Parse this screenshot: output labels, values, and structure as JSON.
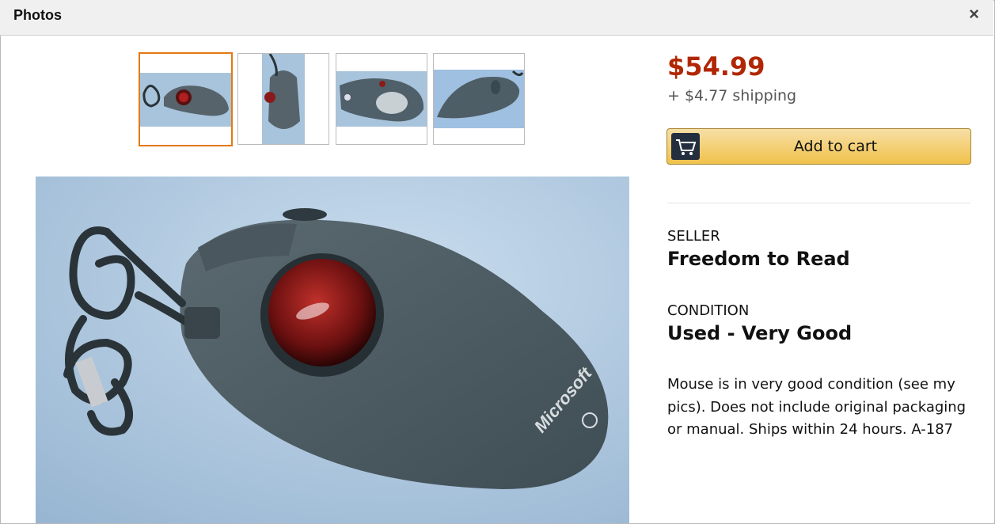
{
  "dialog": {
    "title": "Photos",
    "close_label": "×"
  },
  "thumbnails": [
    {
      "name": "trackball-angle-view",
      "selected": true
    },
    {
      "name": "trackball-top-view",
      "selected": false
    },
    {
      "name": "trackball-side-view",
      "selected": false
    },
    {
      "name": "trackball-bottom-view",
      "selected": false
    }
  ],
  "main_photo": {
    "name": "microsoft-trackball-mouse-photo",
    "logo_text": "Microsoft"
  },
  "offer": {
    "price": "$54.99",
    "shipping": "+ $4.77 shipping",
    "add_to_cart_label": "Add to cart",
    "seller_heading": "SELLER",
    "seller_name": "Freedom to Read",
    "condition_heading": "CONDITION",
    "condition_value": "Used - Very Good",
    "description": "Mouse is in very good condition (see my pics). Does not include original packaging or manual. Ships within 24 hours. A-187"
  },
  "colors": {
    "price": "#b12704",
    "accent_selected": "#e47911",
    "button": "#f0c14b"
  }
}
